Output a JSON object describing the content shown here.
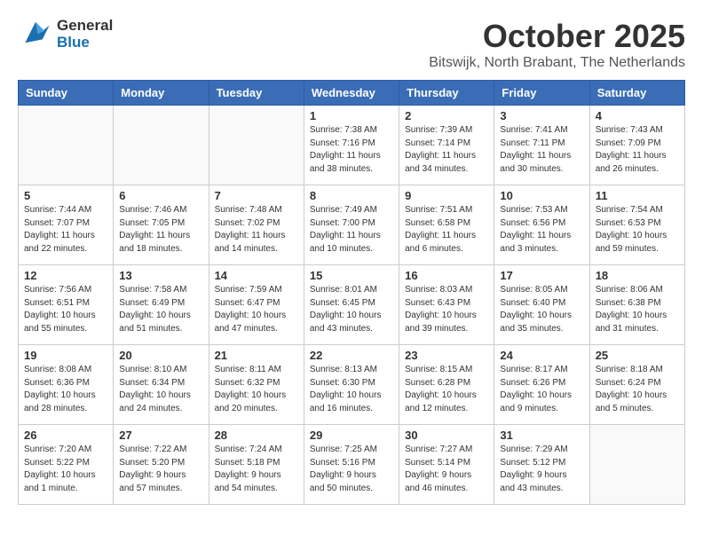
{
  "header": {
    "logo_general": "General",
    "logo_blue": "Blue",
    "title": "October 2025",
    "subtitle": "Bitswijk, North Brabant, The Netherlands"
  },
  "weekdays": [
    "Sunday",
    "Monday",
    "Tuesday",
    "Wednesday",
    "Thursday",
    "Friday",
    "Saturday"
  ],
  "weeks": [
    [
      {
        "day": "",
        "info": ""
      },
      {
        "day": "",
        "info": ""
      },
      {
        "day": "",
        "info": ""
      },
      {
        "day": "1",
        "info": "Sunrise: 7:38 AM\nSunset: 7:16 PM\nDaylight: 11 hours\nand 38 minutes."
      },
      {
        "day": "2",
        "info": "Sunrise: 7:39 AM\nSunset: 7:14 PM\nDaylight: 11 hours\nand 34 minutes."
      },
      {
        "day": "3",
        "info": "Sunrise: 7:41 AM\nSunset: 7:11 PM\nDaylight: 11 hours\nand 30 minutes."
      },
      {
        "day": "4",
        "info": "Sunrise: 7:43 AM\nSunset: 7:09 PM\nDaylight: 11 hours\nand 26 minutes."
      }
    ],
    [
      {
        "day": "5",
        "info": "Sunrise: 7:44 AM\nSunset: 7:07 PM\nDaylight: 11 hours\nand 22 minutes."
      },
      {
        "day": "6",
        "info": "Sunrise: 7:46 AM\nSunset: 7:05 PM\nDaylight: 11 hours\nand 18 minutes."
      },
      {
        "day": "7",
        "info": "Sunrise: 7:48 AM\nSunset: 7:02 PM\nDaylight: 11 hours\nand 14 minutes."
      },
      {
        "day": "8",
        "info": "Sunrise: 7:49 AM\nSunset: 7:00 PM\nDaylight: 11 hours\nand 10 minutes."
      },
      {
        "day": "9",
        "info": "Sunrise: 7:51 AM\nSunset: 6:58 PM\nDaylight: 11 hours\nand 6 minutes."
      },
      {
        "day": "10",
        "info": "Sunrise: 7:53 AM\nSunset: 6:56 PM\nDaylight: 11 hours\nand 3 minutes."
      },
      {
        "day": "11",
        "info": "Sunrise: 7:54 AM\nSunset: 6:53 PM\nDaylight: 10 hours\nand 59 minutes."
      }
    ],
    [
      {
        "day": "12",
        "info": "Sunrise: 7:56 AM\nSunset: 6:51 PM\nDaylight: 10 hours\nand 55 minutes."
      },
      {
        "day": "13",
        "info": "Sunrise: 7:58 AM\nSunset: 6:49 PM\nDaylight: 10 hours\nand 51 minutes."
      },
      {
        "day": "14",
        "info": "Sunrise: 7:59 AM\nSunset: 6:47 PM\nDaylight: 10 hours\nand 47 minutes."
      },
      {
        "day": "15",
        "info": "Sunrise: 8:01 AM\nSunset: 6:45 PM\nDaylight: 10 hours\nand 43 minutes."
      },
      {
        "day": "16",
        "info": "Sunrise: 8:03 AM\nSunset: 6:43 PM\nDaylight: 10 hours\nand 39 minutes."
      },
      {
        "day": "17",
        "info": "Sunrise: 8:05 AM\nSunset: 6:40 PM\nDaylight: 10 hours\nand 35 minutes."
      },
      {
        "day": "18",
        "info": "Sunrise: 8:06 AM\nSunset: 6:38 PM\nDaylight: 10 hours\nand 31 minutes."
      }
    ],
    [
      {
        "day": "19",
        "info": "Sunrise: 8:08 AM\nSunset: 6:36 PM\nDaylight: 10 hours\nand 28 minutes."
      },
      {
        "day": "20",
        "info": "Sunrise: 8:10 AM\nSunset: 6:34 PM\nDaylight: 10 hours\nand 24 minutes."
      },
      {
        "day": "21",
        "info": "Sunrise: 8:11 AM\nSunset: 6:32 PM\nDaylight: 10 hours\nand 20 minutes."
      },
      {
        "day": "22",
        "info": "Sunrise: 8:13 AM\nSunset: 6:30 PM\nDaylight: 10 hours\nand 16 minutes."
      },
      {
        "day": "23",
        "info": "Sunrise: 8:15 AM\nSunset: 6:28 PM\nDaylight: 10 hours\nand 12 minutes."
      },
      {
        "day": "24",
        "info": "Sunrise: 8:17 AM\nSunset: 6:26 PM\nDaylight: 10 hours\nand 9 minutes."
      },
      {
        "day": "25",
        "info": "Sunrise: 8:18 AM\nSunset: 6:24 PM\nDaylight: 10 hours\nand 5 minutes."
      }
    ],
    [
      {
        "day": "26",
        "info": "Sunrise: 7:20 AM\nSunset: 5:22 PM\nDaylight: 10 hours\nand 1 minute."
      },
      {
        "day": "27",
        "info": "Sunrise: 7:22 AM\nSunset: 5:20 PM\nDaylight: 9 hours\nand 57 minutes."
      },
      {
        "day": "28",
        "info": "Sunrise: 7:24 AM\nSunset: 5:18 PM\nDaylight: 9 hours\nand 54 minutes."
      },
      {
        "day": "29",
        "info": "Sunrise: 7:25 AM\nSunset: 5:16 PM\nDaylight: 9 hours\nand 50 minutes."
      },
      {
        "day": "30",
        "info": "Sunrise: 7:27 AM\nSunset: 5:14 PM\nDaylight: 9 hours\nand 46 minutes."
      },
      {
        "day": "31",
        "info": "Sunrise: 7:29 AM\nSunset: 5:12 PM\nDaylight: 9 hours\nand 43 minutes."
      },
      {
        "day": "",
        "info": ""
      }
    ]
  ]
}
